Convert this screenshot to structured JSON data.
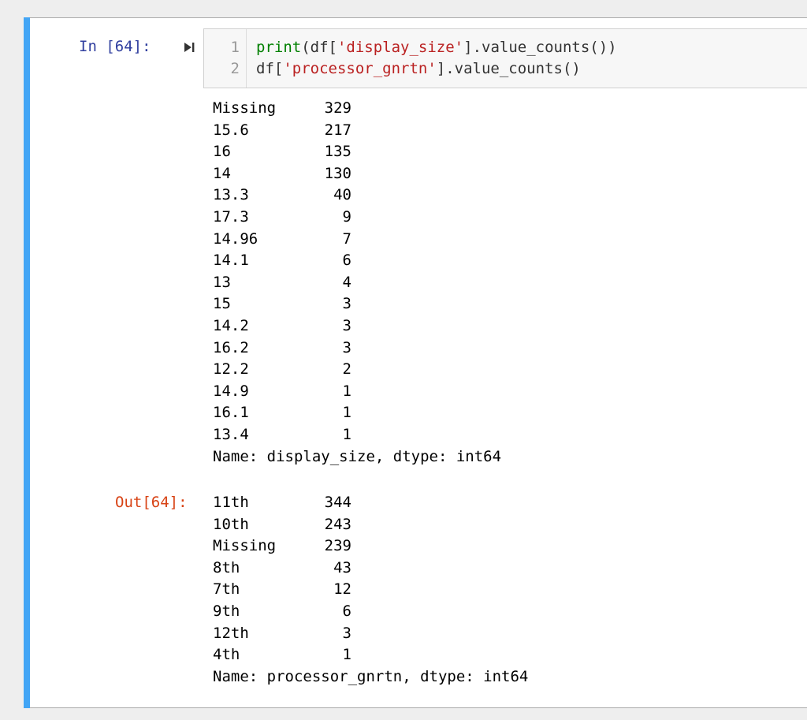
{
  "cell": {
    "in_prompt": "In [64]:",
    "out_prompt": "Out[64]:",
    "code_lines": [
      {
        "num": "1",
        "parts": [
          {
            "t": "print",
            "c": "builtin"
          },
          {
            "t": "(df[",
            "c": "plain"
          },
          {
            "t": "'display_size'",
            "c": "str"
          },
          {
            "t": "].value_counts())",
            "c": "plain"
          }
        ]
      },
      {
        "num": "2",
        "parts": [
          {
            "t": "df[",
            "c": "plain"
          },
          {
            "t": "'processor_gnrtn'",
            "c": "str"
          },
          {
            "t": "].value_counts()",
            "c": "plain"
          }
        ]
      }
    ]
  },
  "stdout": {
    "rows": [
      {
        "label": "Missing",
        "count": "329"
      },
      {
        "label": "15.6",
        "count": "217"
      },
      {
        "label": "16",
        "count": "135"
      },
      {
        "label": "14",
        "count": "130"
      },
      {
        "label": "13.3",
        "count": "40"
      },
      {
        "label": "17.3",
        "count": "9"
      },
      {
        "label": "14.96",
        "count": "7"
      },
      {
        "label": "14.1",
        "count": "6"
      },
      {
        "label": "13",
        "count": "4"
      },
      {
        "label": "15",
        "count": "3"
      },
      {
        "label": "14.2",
        "count": "3"
      },
      {
        "label": "16.2",
        "count": "3"
      },
      {
        "label": "12.2",
        "count": "2"
      },
      {
        "label": "14.9",
        "count": "1"
      },
      {
        "label": "16.1",
        "count": "1"
      },
      {
        "label": "13.4",
        "count": "1"
      }
    ],
    "footer": "Name: display_size, dtype: int64"
  },
  "result": {
    "rows": [
      {
        "label": "11th",
        "count": "344"
      },
      {
        "label": "10th",
        "count": "243"
      },
      {
        "label": "Missing",
        "count": "239"
      },
      {
        "label": "8th",
        "count": "43"
      },
      {
        "label": "7th",
        "count": "12"
      },
      {
        "label": "9th",
        "count": "6"
      },
      {
        "label": "12th",
        "count": "3"
      },
      {
        "label": "4th",
        "count": "1"
      }
    ],
    "footer": "Name: processor_gnrtn, dtype: int64"
  },
  "icons": {
    "run": "run-cell-icon"
  }
}
